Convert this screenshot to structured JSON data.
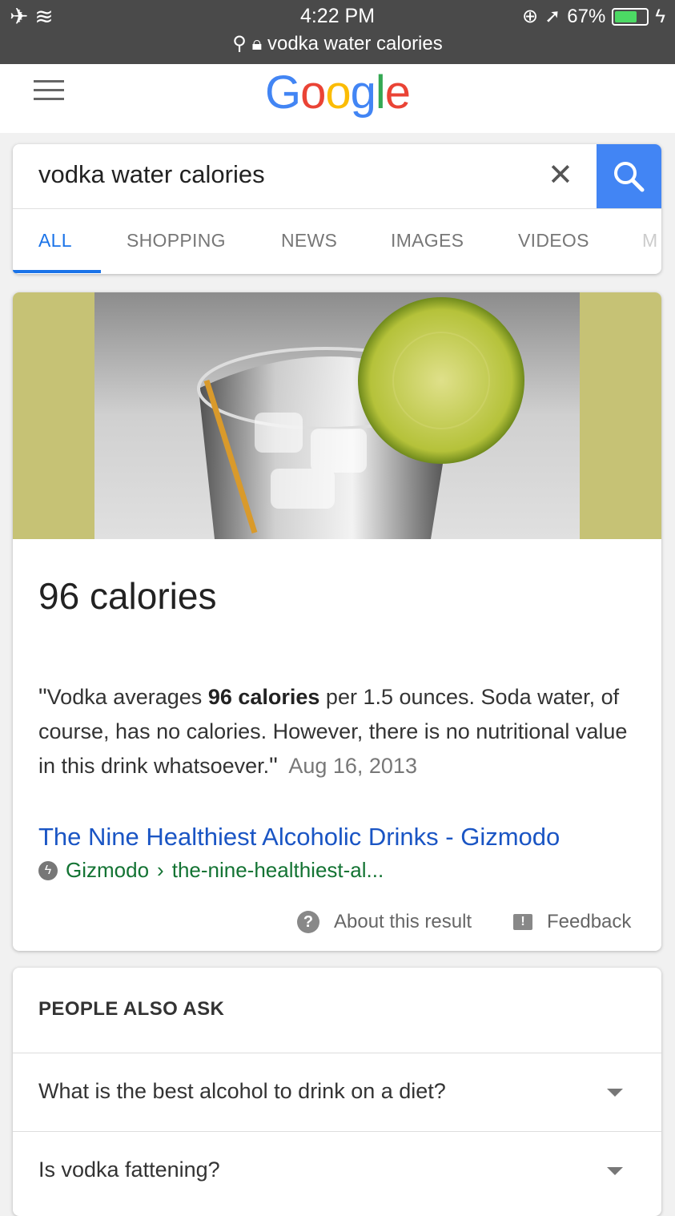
{
  "status_bar": {
    "time": "4:22 PM",
    "battery": "67%",
    "battery_level": 0.67,
    "url": "vodka water calories"
  },
  "header": {
    "logo": "Google",
    "logo_colors": [
      "#4285F4",
      "#EA4335",
      "#FBBC05",
      "#4285F4",
      "#34A853",
      "#EA4335"
    ]
  },
  "search": {
    "query": "vodka water calories",
    "tabs": [
      "ALL",
      "SHOPPING",
      "NEWS",
      "IMAGES",
      "VIDEOS",
      "M"
    ],
    "active_tab": "ALL"
  },
  "answer": {
    "title": "96 calories",
    "snippet_prefix": "Vodka averages ",
    "snippet_bold": "96 calories",
    "snippet_suffix": " per 1.5 ounces. Soda water, of course, has no calories. However, there is no nutritional value in this drink whatsoever.",
    "date": "Aug 16, 2013",
    "result_title": "The Nine Healthiest Alcoholic Drinks - Gizmodo",
    "result_site": "Gizmodo",
    "result_path": "the-nine-healthiest-al...",
    "about_label": "About this result",
    "feedback_label": "Feedback"
  },
  "people_also_ask": {
    "header": "PEOPLE ALSO ASK",
    "questions": [
      "What is the best alcohol to drink on a diet?",
      "Is vodka fattening?"
    ]
  }
}
